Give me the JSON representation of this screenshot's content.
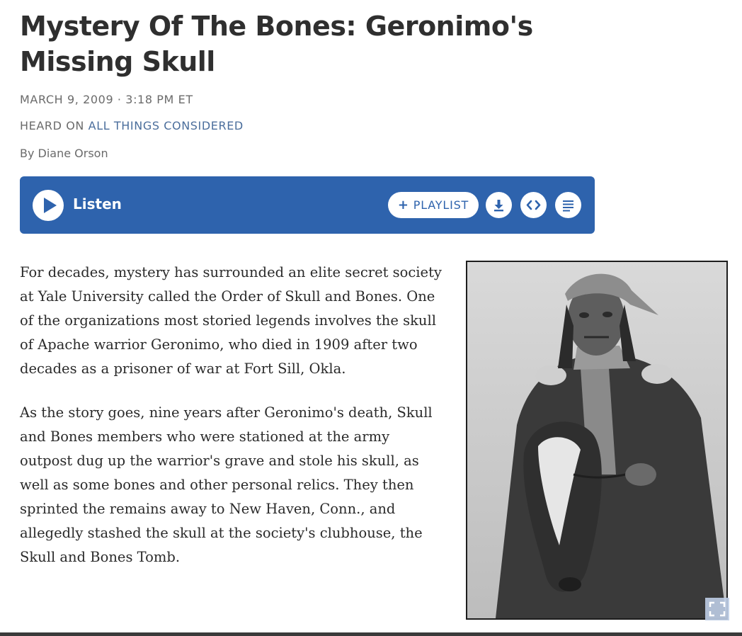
{
  "article": {
    "title": "Mystery Of The Bones: Geronimo's Missing Skull",
    "date": "MARCH 9, 2009 · 3:18 PM ET",
    "heard_on_label": "HEARD ON",
    "program": "ALL THINGS CONSIDERED",
    "byline": "By Diane Orson"
  },
  "player": {
    "listen_label": "Listen",
    "playlist_label": "PLAYLIST",
    "play_icon": "play-icon",
    "download_icon": "download-icon",
    "embed_icon": "embed-code-icon",
    "transcript_icon": "transcript-icon",
    "background": "#2e63ad"
  },
  "body": {
    "paragraphs": [
      "For decades, mystery has surrounded an elite secret society at Yale University called the Order of Skull and Bones. One of the organizations most storied legends involves the skull of Apache warrior Geronimo, who died in 1909 after two decades as a prisoner of war at Fort Sill, Okla.",
      "As the story goes, nine years after Geronimo's death, Skull and Bones members who were stationed at the army outpost dug up the warrior's grave and stole his skull, as well as some bones and other personal relics. They then sprinted the remains away to New Haven, Conn., and allegedly stashed the skull at the society's clubhouse, the Skull and Bones Tomb."
    ]
  },
  "photo": {
    "expand_icon": "expand-icon"
  },
  "colors": {
    "link": "#4b6e9c",
    "title": "#2f2f2f",
    "meta": "#6b6b6b"
  }
}
